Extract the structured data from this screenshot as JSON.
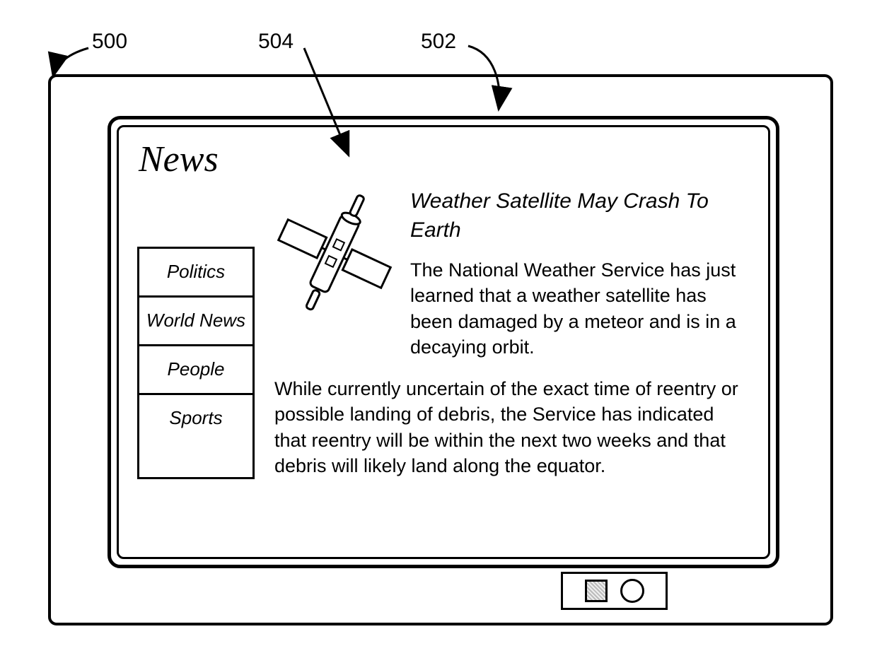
{
  "callouts": {
    "c500": "500",
    "c504": "504",
    "c502": "502"
  },
  "page": {
    "title": "News"
  },
  "sidebar": {
    "items": [
      {
        "label": "Politics"
      },
      {
        "label": "World News"
      },
      {
        "label": "People"
      },
      {
        "label": "Sports"
      }
    ]
  },
  "article": {
    "headline": "Weather Satellite May Crash To Earth",
    "lead": "The National Weather Service has just learned that a weather satellite has been damaged by a meteor and is in a decaying orbit.",
    "para2": "While currently uncertain of the exact time of reentry or possible landing of debris, the Service has indicated that reentry will be within the next two weeks and that debris will likely land along the equator."
  }
}
